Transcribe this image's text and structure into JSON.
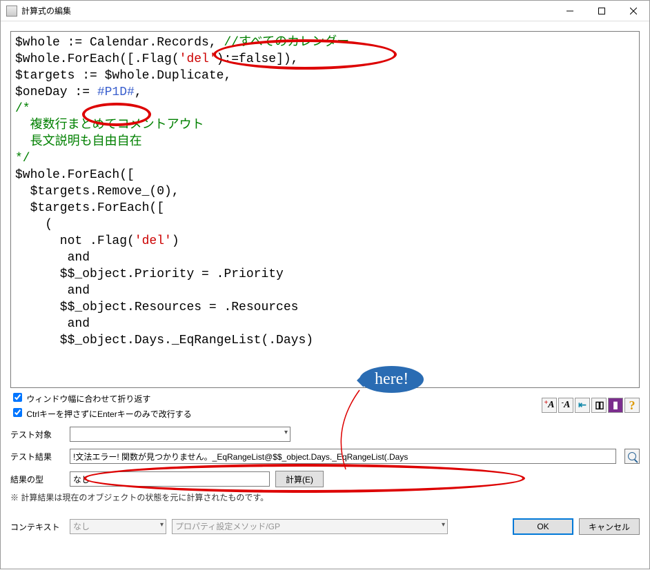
{
  "window": {
    "title": "計算式の編集"
  },
  "code": {
    "l1a": "$whole := Calendar.Records, ",
    "l1b": "//すべてのカレンダー",
    "l2a": "$whole.ForEach([.Flag(",
    "l2s": "'del'",
    "l2b": "):=false]),",
    "l3": "$targets := $whole.Duplicate,",
    "l4a": "$oneDay := ",
    "l4l": "#P1D#",
    "l4b": ",",
    "l5": "/*",
    "l6": "  複数行まとめてコメントアウト",
    "l7": "  長文説明も自由自在",
    "l8": "*/",
    "l9": "$whole.ForEach([",
    "l10": "  $targets.Remove_(0),",
    "l11": "  $targets.ForEach([",
    "l12": "    (",
    "l13a": "      not .Flag(",
    "l13s": "'del'",
    "l13b": ")",
    "l14": "       and",
    "l15": "      $$_object.Priority = .Priority",
    "l16": "       and",
    "l17": "      $$_object.Resources = .Resources",
    "l18": "       and",
    "l19": "      $$_object.Days._EqRangeList(.Days)"
  },
  "opts": {
    "wrap": "ウィンドウ幅に合わせて折り返す",
    "enter": "Ctrlキーを押さずにEnterキーのみで改行する"
  },
  "form": {
    "test_target_label": "テスト対象",
    "test_target_value": "",
    "test_result_label": "テスト結果",
    "test_result_value": "!文法エラー! 関数が見つかりません。_EqRangeList@$$_object.Days._EqRangeList(.Days",
    "result_type_label": "結果の型",
    "result_type_value": "なし",
    "compute_btn": "計算(E)",
    "note": "※ 計算結果は現在のオブジェクトの状態を元に計算されたものです。",
    "context_label": "コンテキスト",
    "context_value": "なし",
    "context_path": "プロパティ設定メソッド/GP",
    "ok": "OK",
    "cancel": "キャンセル"
  },
  "callout": {
    "text": "here!"
  }
}
